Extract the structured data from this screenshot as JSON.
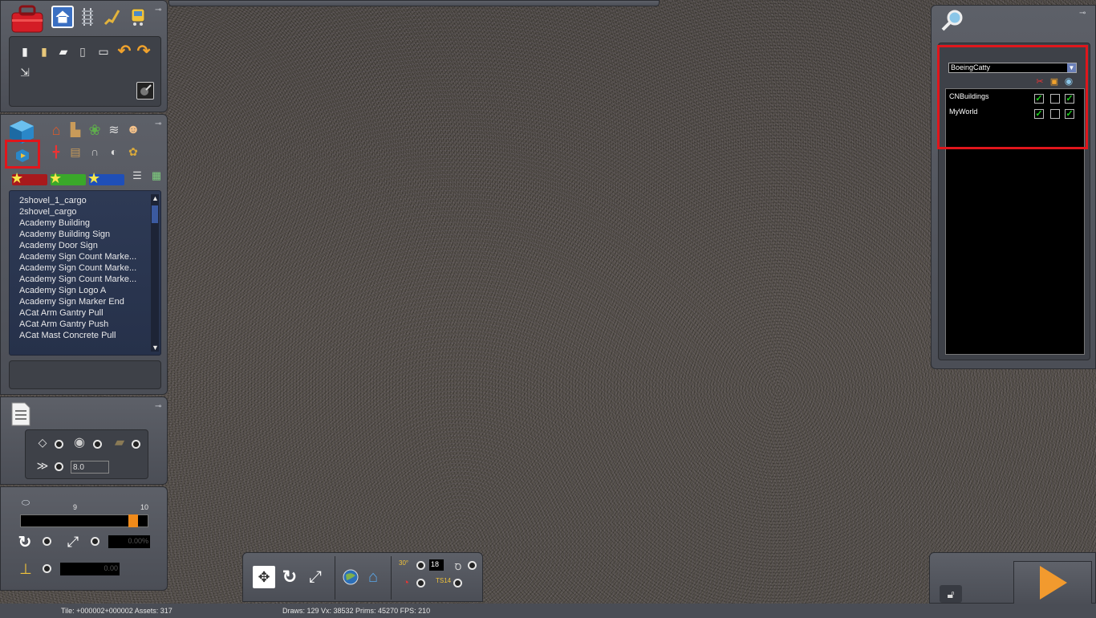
{
  "toolbar_left": {
    "main_icons": [
      "toolbox-icon",
      "home-icon",
      "track-icon",
      "paint-icon",
      "train-icon"
    ],
    "edit_icons": [
      "copy-icon",
      "paste-icon",
      "move-icon",
      "delete-icon",
      "settings-icon",
      "undo-icon",
      "redo-icon"
    ]
  },
  "assets": {
    "tools": [
      "home-icon",
      "industry-icon",
      "tree-icon",
      "fence-icon",
      "person-icon",
      "junction-icon",
      "track-icon",
      "bridge-icon",
      "signal-icon",
      "speaker-icon"
    ],
    "items": [
      "2shovel_1_cargo",
      "2shovel_cargo",
      "Academy Building",
      "Academy Building Sign",
      "Academy Door Sign",
      "Academy Sign Count Marke...",
      "Academy Sign Count Marke...",
      "Academy Sign Count Marke...",
      "Academy Sign Logo A",
      "Academy Sign Marker End",
      "ACat Arm Gantry Pull",
      "ACat Arm Gantry Push",
      "ACat Mast Concrete Pull"
    ]
  },
  "height_panel": {
    "spacing_value": "8.0"
  },
  "slider_panel": {
    "min_label": "9",
    "max_label": "10",
    "percent_value": "0.00%",
    "height_value": "0.00"
  },
  "layers": {
    "selected_layer": "BoeingCatty",
    "rows": [
      {
        "name": "CNBuildings",
        "lock": true,
        "tracks": false,
        "visible": true
      },
      {
        "name": "MyWorld",
        "lock": true,
        "tracks": false,
        "visible": true
      }
    ],
    "check_mark": "✓"
  },
  "bottom_toolbar": {
    "grid_value": "18",
    "ts_label": "TS14",
    "angle_label": "30°"
  },
  "status": {
    "left": "Tile: +000002+000002  Assets: 317",
    "center": "Draws: 129 Vx: 38532 Prims: 45270 FPS: 210"
  },
  "colors": {
    "panel": "#55585f",
    "highlight": "#e0161c",
    "list_bg": "#2d3852",
    "accent_orange": "#f08a1a"
  }
}
